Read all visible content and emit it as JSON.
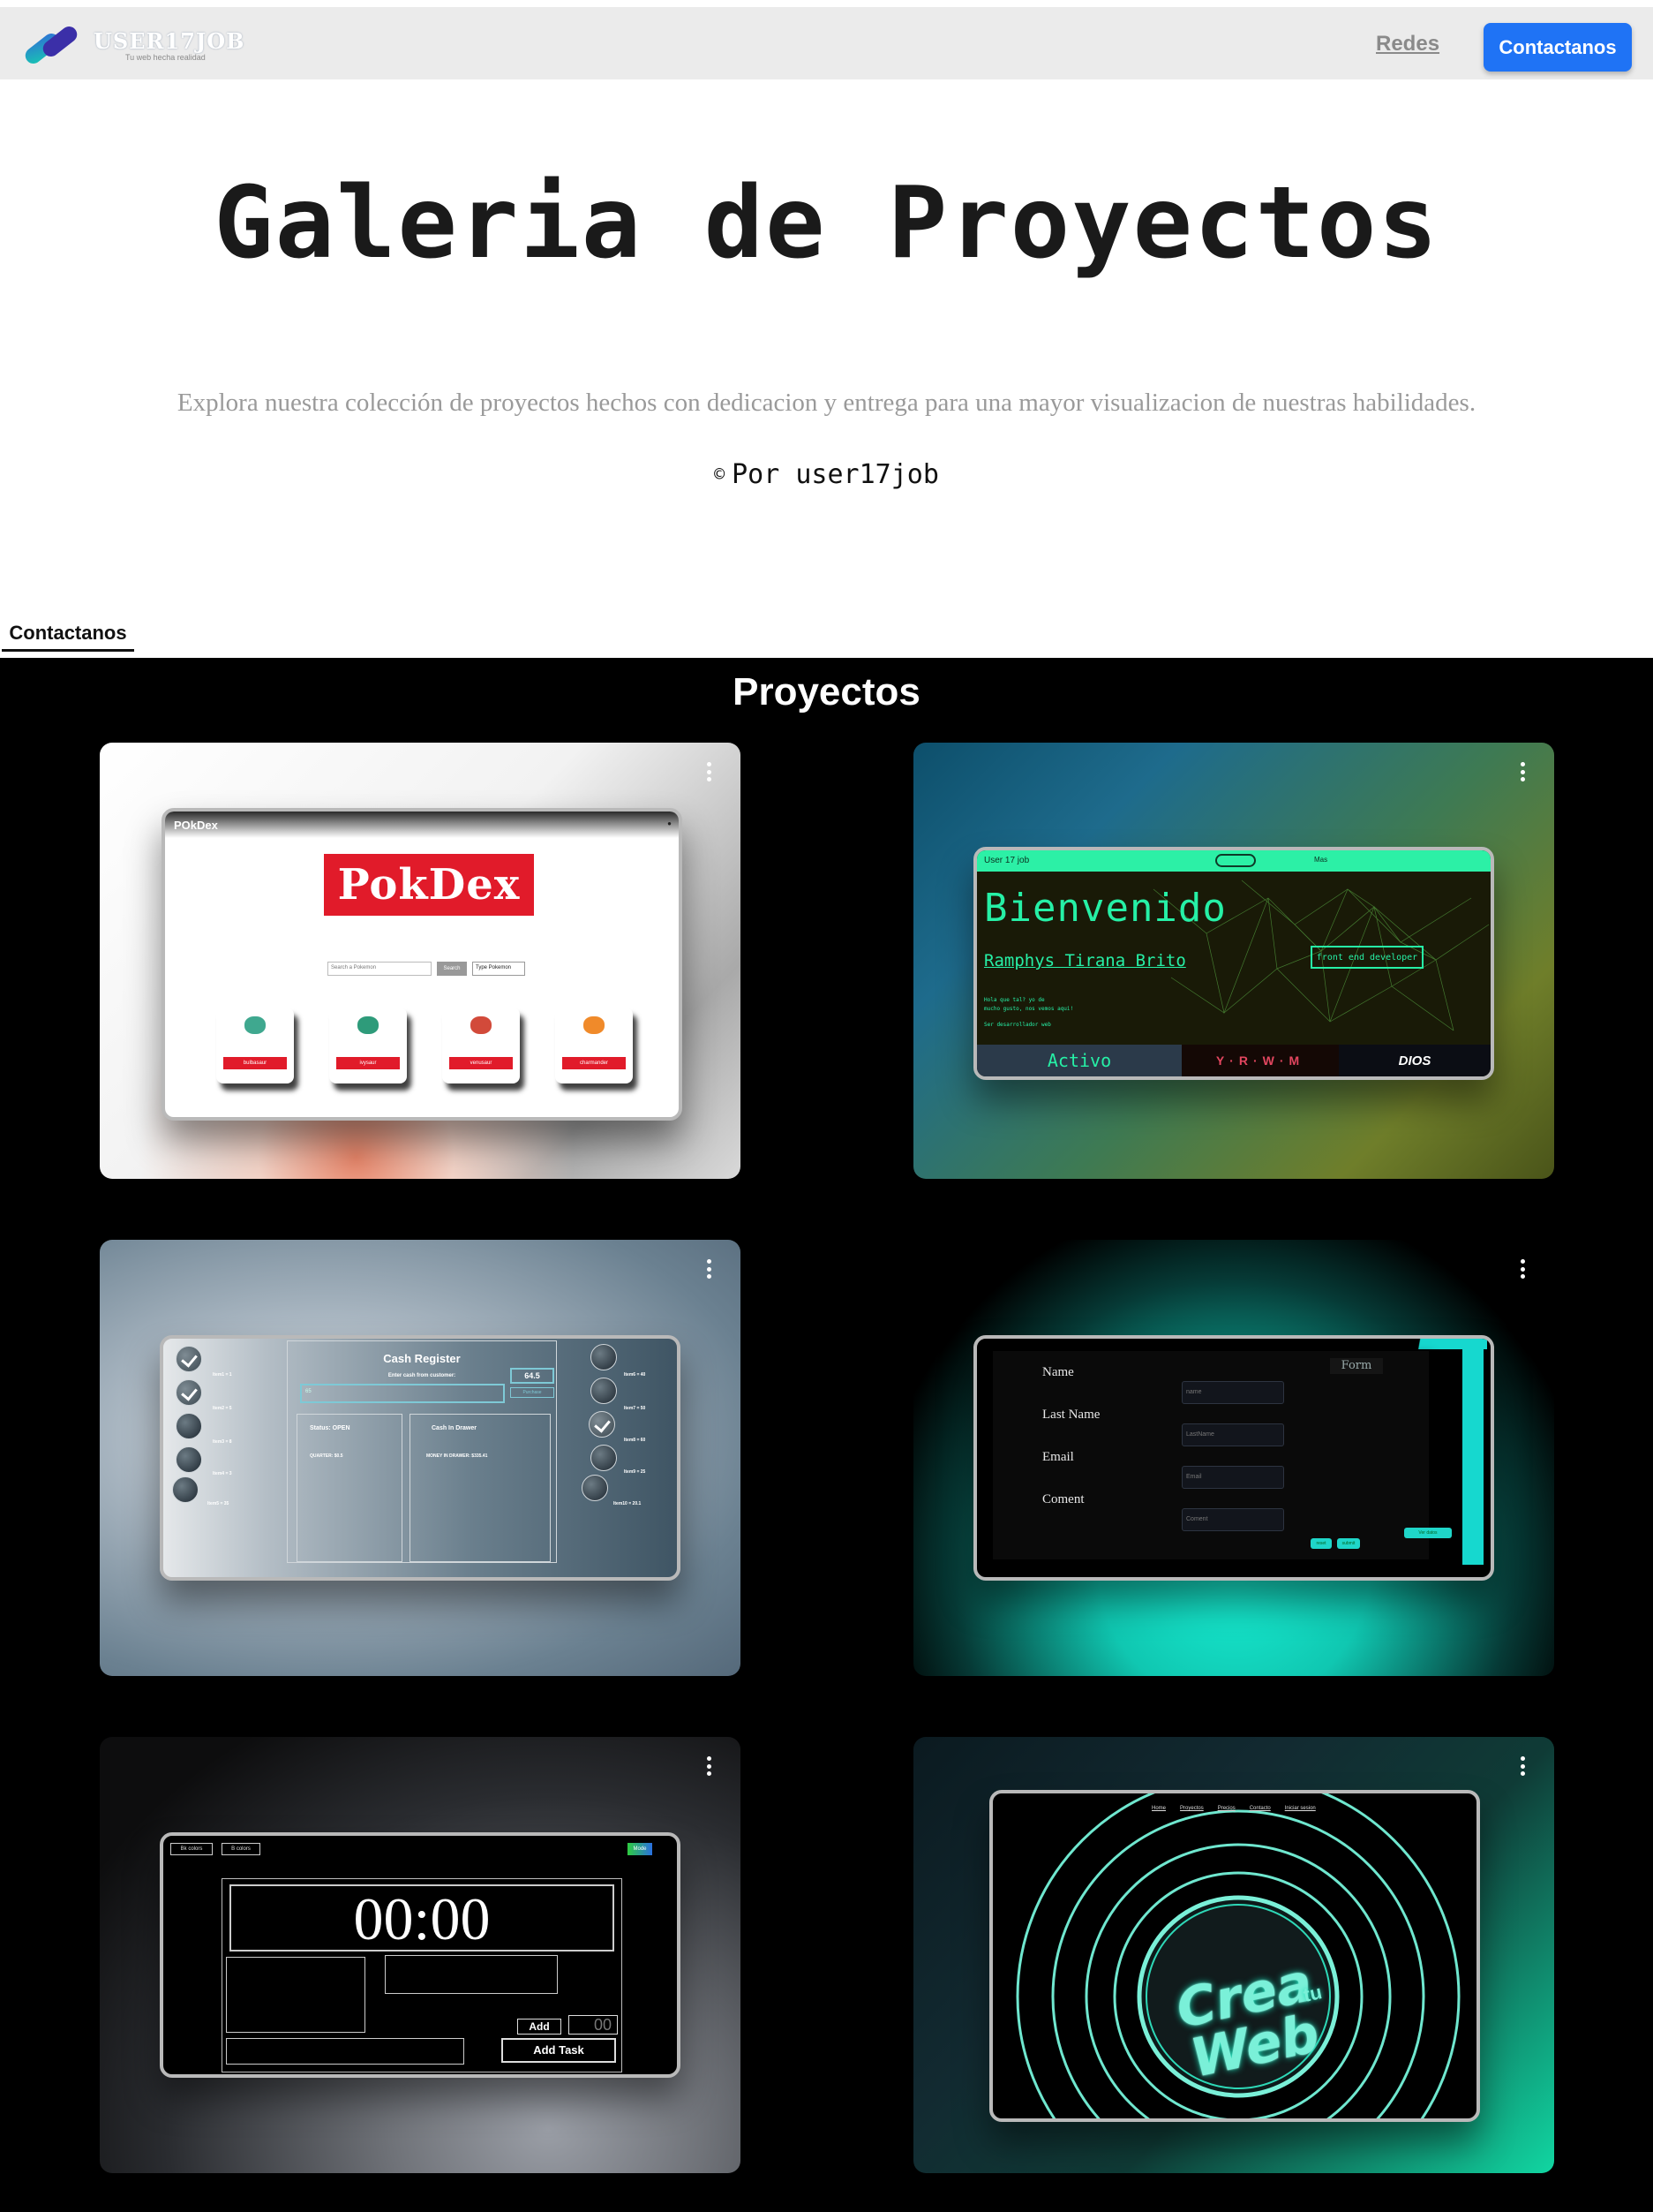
{
  "header": {
    "logo_text": "USER17JOB",
    "logo_tagline": "Tu web hecha realidad",
    "nav_redes": "Redes",
    "nav_contact": "Contactanos"
  },
  "hero": {
    "title": "Galeria de Proyectos",
    "subtitle": "Explora nuestra colección de proyectos hechos con dedicacion y entrega para una mayor visualizacion de nuestras habilidades.",
    "credit_symbol": "©",
    "credit": "Por user17job"
  },
  "contact_tab": "Contactanos",
  "projects": {
    "heading": "Proyectos",
    "pokdex": {
      "bar_title": "POkDex",
      "logo": "PokDex",
      "search_placeholder": "Search a Pokemon",
      "search_button": "Search",
      "type_select": "Type Pokemon",
      "pokemon": [
        "bulbasaur",
        "ivysaur",
        "venusaur",
        "charmander"
      ],
      "sprite_colors": [
        "#3fa88f",
        "#2e9b7a",
        "#d24a3a",
        "#f08a2a"
      ]
    },
    "bienvenido": {
      "bar_name": "User 17 job",
      "bar_menu": "Mas",
      "title": "Bienvenido",
      "name": "Ramphys Tirana Brito",
      "role": "front end developer",
      "line1": "Hola que tal? yo de",
      "line2": "mucho gusto, nos vemos aqui!",
      "line3": "Ser desarrollador web",
      "status": "Activo",
      "brand1": "Y·R·W·M",
      "brand2": "DIOS"
    },
    "cash_register": {
      "title": "Cash Register",
      "enter_label": "Enter cash from customer:",
      "input_value": "65",
      "total": "64.5",
      "purchase": "Purchase",
      "status": "Status: OPEN",
      "in_drawer": "Cash In Drawer",
      "quarter": "QUARTER: $0.5",
      "money_in_drawer": "MONEY IN DRAWER: $335.41",
      "left_items": [
        "Item1 = 1",
        "Item2 = 5",
        "Item3 = 8",
        "Item4 = 3",
        "Item5 = 35"
      ],
      "right_items": [
        "Item6 = 40",
        "Item7 = 50",
        "Item8 = 60",
        "Item9 = 25",
        "Item10 = 20.1"
      ]
    },
    "form": {
      "title": "Form",
      "labels": [
        "Name",
        "Last Name",
        "Email",
        "Coment"
      ],
      "placeholders": [
        "name",
        "LastName",
        "Email",
        "Coment"
      ],
      "buttons": [
        "reset",
        "submit"
      ],
      "extra_button": "Ver datos"
    },
    "tasks": {
      "btn1": "Bk colors",
      "btn2": "B colors",
      "mode": "Mode",
      "time": "00:00",
      "add": "Add",
      "count": "00",
      "add_task": "Add Task"
    },
    "crea_web": {
      "nav": [
        "Home",
        "Proyectos",
        "Precios",
        "Contacto",
        "Iniciar sesion"
      ],
      "title_line1": "Crea",
      "title_line2": "Web",
      "tu": "tu"
    }
  }
}
